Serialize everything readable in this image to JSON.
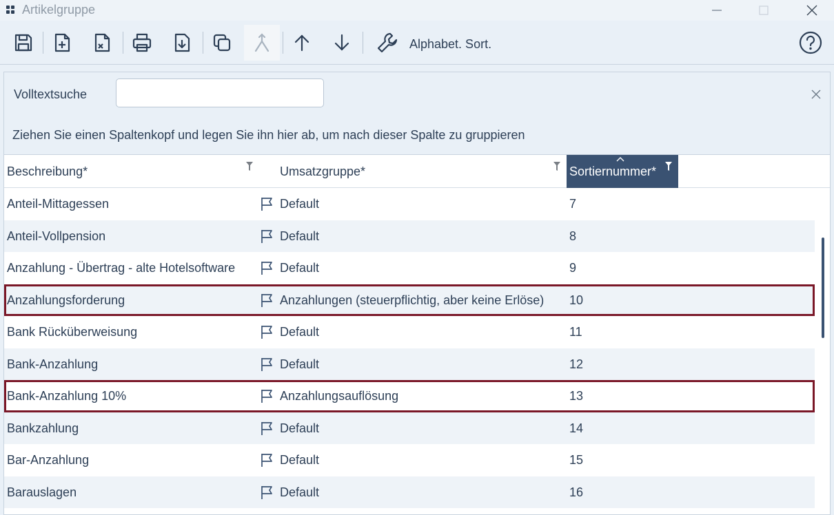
{
  "window": {
    "title": "Artikelgruppe"
  },
  "toolbar": {
    "buttons": [
      {
        "name": "save-icon"
      },
      {
        "name": "new-record-icon"
      },
      {
        "name": "delete-record-icon"
      },
      {
        "name": "print-icon"
      },
      {
        "name": "download-icon"
      },
      {
        "name": "copy-icon"
      },
      {
        "name": "merge-icon"
      },
      {
        "name": "arrow-up-icon"
      },
      {
        "name": "arrow-down-icon"
      },
      {
        "name": "wrench-icon"
      }
    ],
    "sort_label": "Alphabet. Sort.",
    "help_icon": "help-icon"
  },
  "search": {
    "label": "Volltextsuche",
    "value": "",
    "placeholder": ""
  },
  "group_hint": "Ziehen Sie einen Spaltenkopf und legen Sie ihn hier ab, um nach dieser Spalte zu gruppieren",
  "columns": {
    "description": "Beschreibung*",
    "revenue_group": "Umsatzgruppe*",
    "sort_number": "Sortiernummer*"
  },
  "rows": [
    {
      "description": "Anteil-Mittagessen",
      "revenue_group": "Default",
      "sort_number": "7",
      "highlighted": false
    },
    {
      "description": "Anteil-Vollpension",
      "revenue_group": "Default",
      "sort_number": "8",
      "highlighted": false
    },
    {
      "description": "Anzahlung - Übertrag - alte Hotelsoftware",
      "revenue_group": "Default",
      "sort_number": "9",
      "highlighted": false
    },
    {
      "description": "Anzahlungsforderung",
      "revenue_group": "Anzahlungen (steuerpflichtig, aber keine Erlöse)",
      "sort_number": "10",
      "highlighted": true
    },
    {
      "description": "Bank Rücküberweisung",
      "revenue_group": "Default",
      "sort_number": "11",
      "highlighted": false
    },
    {
      "description": "Bank-Anzahlung",
      "revenue_group": "Default",
      "sort_number": "12",
      "highlighted": false
    },
    {
      "description": "Bank-Anzahlung 10%",
      "revenue_group": "Anzahlungsauflösung",
      "sort_number": "13",
      "highlighted": true
    },
    {
      "description": "Bankzahlung",
      "revenue_group": "Default",
      "sort_number": "14",
      "highlighted": false
    },
    {
      "description": "Bar-Anzahlung",
      "revenue_group": "Default",
      "sort_number": "15",
      "highlighted": false
    },
    {
      "description": "Barauslagen",
      "revenue_group": "Default",
      "sort_number": "16",
      "highlighted": false
    }
  ],
  "colors": {
    "accent": "#3a5272",
    "highlight_border": "#7a1727",
    "background": "#e9f0f7"
  }
}
